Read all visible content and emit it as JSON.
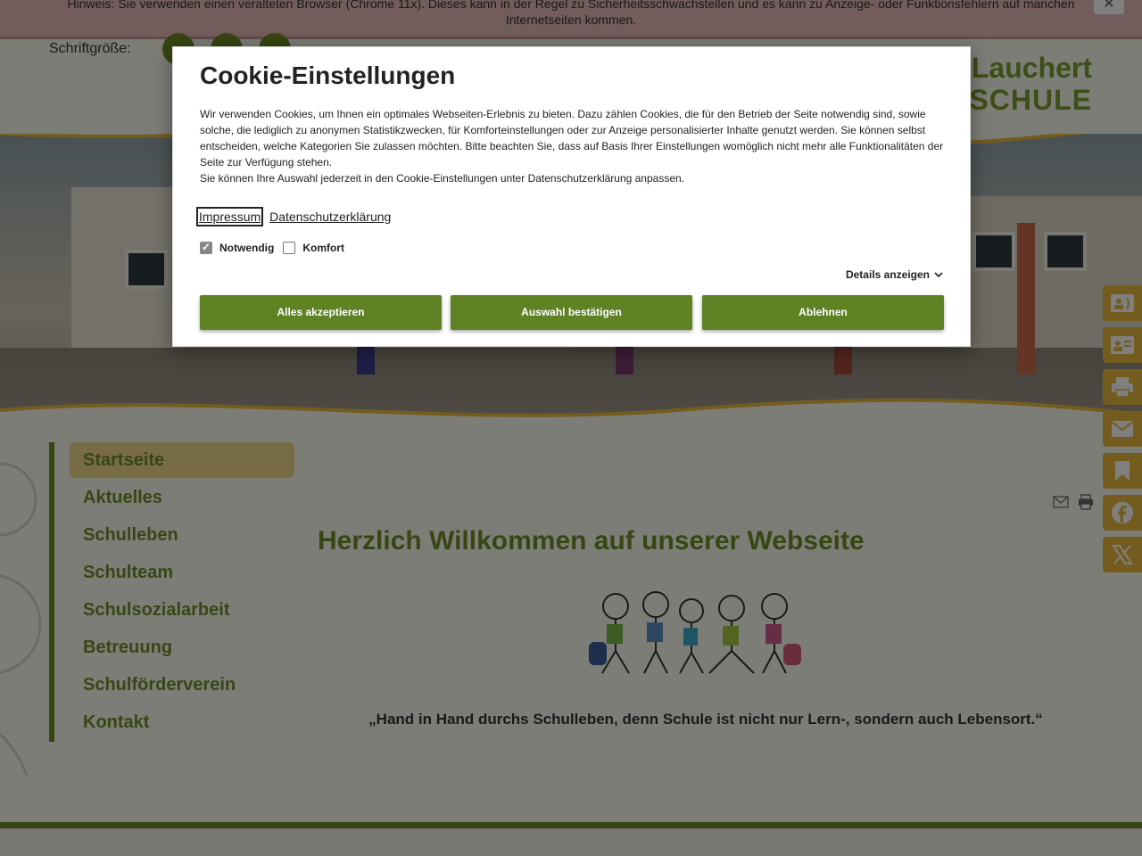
{
  "notice": {
    "line1": "Hinweis: Sie verwenden einen veralteten Browser (Chrome 11x). Dieses kann in der Regel zu Sicherheitsschwachstellen und es kann zu Anzeige- oder Funktionsfehlern auf manchen",
    "line2": "Internetseiten kommen.",
    "close": "✕"
  },
  "header": {
    "font_size_label": "Schriftgröße:",
    "school_name_line1": "Lauchert",
    "school_name_line2": "DSCHULE"
  },
  "nav": {
    "items": [
      {
        "label": "Startseite",
        "active": true
      },
      {
        "label": "Aktuelles"
      },
      {
        "label": "Schulleben"
      },
      {
        "label": "Schulteam"
      },
      {
        "label": "Schulsozialarbeit"
      },
      {
        "label": "Betreuung"
      },
      {
        "label": "Schulförderverein"
      },
      {
        "label": "Kontakt"
      }
    ]
  },
  "main": {
    "heading": "Herzlich Willkommen auf unserer Webseite",
    "quote": "„Hand in Hand durchs Schulleben, denn Schule ist nicht nur Lern-, sondern auch Lebensort.“"
  },
  "side_tools": [
    "contact-phone-icon",
    "contact-card-icon",
    "print-icon",
    "mail-icon",
    "bookmark-icon",
    "facebook-icon",
    "x-twitter-icon"
  ],
  "cookie_dialog": {
    "title": "Cookie-Einstellungen",
    "text_1": "Wir verwenden Cookies, um Ihnen ein optimales Webseiten-Erlebnis zu bieten. Dazu zählen Cookies, die für den Betrieb der Seite notwendig sind, sowie solche, die lediglich zu anonymen Statistikzwecken, für Komforteinstellungen oder zur Anzeige personalisierter Inhalte genutzt werden. Sie können selbst entscheiden, welche Kategorien Sie zulassen möchten. Bitte beachten Sie, dass auf Basis Ihrer Einstellungen womöglich nicht mehr alle Funktionalitäten der Seite zur Verfügung stehen.",
    "text_2": "Sie können Ihre Auswahl jederzeit in den Cookie-Einstellungen unter Datenschutzerklärung anpassen.",
    "link_impressum": "Impressum",
    "link_datenschutz": "Datenschutzerklärung",
    "option_necessary": "Notwendig",
    "option_necessary_checked": true,
    "option_comfort": "Komfort",
    "option_comfort_checked": false,
    "details_label": "Details anzeigen",
    "btn_accept_all": "Alles akzeptieren",
    "btn_confirm": "Auswahl bestätigen",
    "btn_reject": "Ablehnen"
  },
  "colors": {
    "brand_green": "#6f8d27",
    "button_green": "#5e8224",
    "accent_yellow": "#e7b93a",
    "nav_active_bg": "#f1d98a"
  }
}
